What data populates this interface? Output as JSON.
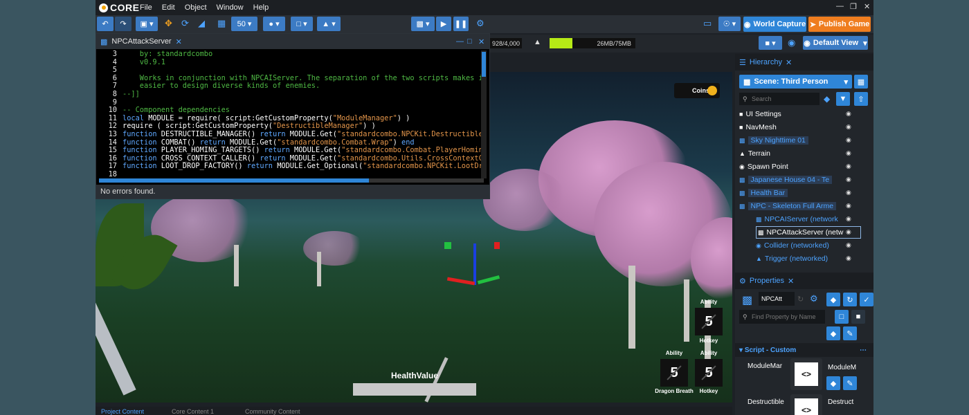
{
  "app": {
    "logo": "CORE"
  },
  "menu": [
    "File",
    "Edit",
    "Object",
    "Window",
    "Help"
  ],
  "toolbar": {
    "grid_size": "50",
    "world_capture": "World Capture",
    "publish": "Publish Game"
  },
  "stats": {
    "instances": "928/4,000",
    "memory": "26MB/75MB",
    "memory_fill_percent": 27
  },
  "view": {
    "default_view": "Default View"
  },
  "editor": {
    "tab": "NPCAttackServer",
    "status": "No errors found.",
    "lines": [
      {
        "n": "3",
        "parts": [
          {
            "t": "    by: standardcombo",
            "c": "cmt"
          }
        ]
      },
      {
        "n": "4",
        "parts": [
          {
            "t": "    v0.9.1",
            "c": "cmt"
          }
        ]
      },
      {
        "n": "5",
        "parts": [
          {
            "t": "",
            "c": "src"
          }
        ]
      },
      {
        "n": "6",
        "parts": [
          {
            "t": "    Works in conjunction with NPCAIServer. The separation of the two scripts makes it",
            "c": "cmt"
          }
        ]
      },
      {
        "n": "7",
        "parts": [
          {
            "t": "    easier to design diverse kinds of enemies.",
            "c": "cmt"
          }
        ]
      },
      {
        "n": "8",
        "parts": [
          {
            "t": "--]]",
            "c": "cmt"
          }
        ]
      },
      {
        "n": "9",
        "parts": [
          {
            "t": "",
            "c": "src"
          }
        ]
      },
      {
        "n": "10",
        "parts": [
          {
            "t": "-- Component dependencies",
            "c": "cmt"
          }
        ]
      },
      {
        "n": "11",
        "parts": [
          {
            "t": "local",
            "c": "kw"
          },
          {
            "t": " MODULE = require( script:GetCustomProperty(",
            "c": "src"
          },
          {
            "t": "\"ModuleManager\"",
            "c": "str"
          },
          {
            "t": ") )",
            "c": "src"
          }
        ]
      },
      {
        "n": "12",
        "parts": [
          {
            "t": "require ( script:GetCustomProperty(",
            "c": "src"
          },
          {
            "t": "\"DestructibleManager\"",
            "c": "str"
          },
          {
            "t": ") )",
            "c": "src"
          }
        ]
      },
      {
        "n": "13",
        "parts": [
          {
            "t": "function",
            "c": "kw"
          },
          {
            "t": " DESTRUCTIBLE_MANAGER() ",
            "c": "src"
          },
          {
            "t": "return",
            "c": "kw"
          },
          {
            "t": " MODULE.Get(",
            "c": "src"
          },
          {
            "t": "\"standardcombo.NPCKit.DestructibleMan",
            "c": "str"
          }
        ]
      },
      {
        "n": "14",
        "parts": [
          {
            "t": "function",
            "c": "kw"
          },
          {
            "t": " COMBAT() ",
            "c": "src"
          },
          {
            "t": "return",
            "c": "kw"
          },
          {
            "t": " MODULE.Get(",
            "c": "src"
          },
          {
            "t": "\"standardcombo.Combat.Wrap\"",
            "c": "str"
          },
          {
            "t": ") ",
            "c": "src"
          },
          {
            "t": "end",
            "c": "kw"
          }
        ]
      },
      {
        "n": "15",
        "parts": [
          {
            "t": "function",
            "c": "kw"
          },
          {
            "t": " PLAYER_HOMING_TARGETS() ",
            "c": "src"
          },
          {
            "t": "return",
            "c": "kw"
          },
          {
            "t": " MODULE.Get(",
            "c": "src"
          },
          {
            "t": "\"standardcombo.Combat.PlayerHomingTa",
            "c": "str"
          }
        ]
      },
      {
        "n": "16",
        "parts": [
          {
            "t": "function",
            "c": "kw"
          },
          {
            "t": " CROSS_CONTEXT_CALLER() ",
            "c": "src"
          },
          {
            "t": "return",
            "c": "kw"
          },
          {
            "t": " MODULE.Get(",
            "c": "src"
          },
          {
            "t": "\"standardcombo.Utils.CrossContextCall",
            "c": "str"
          }
        ]
      },
      {
        "n": "17",
        "parts": [
          {
            "t": "function",
            "c": "kw"
          },
          {
            "t": " LOOT_DROP_FACTORY() ",
            "c": "src"
          },
          {
            "t": "return",
            "c": "kw"
          },
          {
            "t": " MODULE.Get_Optional(",
            "c": "src"
          },
          {
            "t": "\"standardcombo.NPCKit.LootDropF",
            "c": "str"
          }
        ]
      },
      {
        "n": "18",
        "parts": [
          {
            "t": "",
            "c": "src"
          }
        ]
      }
    ]
  },
  "hud": {
    "coins_label": "Coins",
    "abilities": [
      {
        "label": "Ability",
        "value": "5",
        "hotkey": "Hotkey"
      },
      {
        "label": "Ability",
        "value": "5",
        "hotkey": "Dragon Breath"
      },
      {
        "label": "Ability",
        "value": "5",
        "hotkey": "Hotkey"
      }
    ],
    "health_label": "HealthValue"
  },
  "hierarchy": {
    "title": "Hierarchy",
    "scene": "Scene: Third Person",
    "search_placeholder": "Search",
    "items": [
      {
        "label": "UI Settings",
        "style": "white"
      },
      {
        "label": "NavMesh",
        "style": "white"
      },
      {
        "label": "Sky Nighttime 01",
        "style": "blue-sel"
      },
      {
        "label": "Terrain",
        "style": "white"
      },
      {
        "label": "Spawn Point",
        "style": "white"
      },
      {
        "label": "Japanese House 04 - Te",
        "style": "blue-sel"
      },
      {
        "label": "Health Bar",
        "style": "blue-sel"
      },
      {
        "label": "NPC - Skeleton Full Arme",
        "style": "blue-sel"
      },
      {
        "label": "NPCAIServer (network",
        "style": "blue"
      },
      {
        "label": "NPCAttackServer (netw",
        "style": "white-selected"
      },
      {
        "label": "Collider (networked)",
        "style": "blue"
      },
      {
        "label": "Trigger (networked)",
        "style": "blue"
      }
    ]
  },
  "properties": {
    "title": "Properties",
    "name_value": "NPCAtt",
    "find_placeholder": "Find Property by Name",
    "section": "Script - Custom",
    "custom": [
      {
        "label": "ModuleMar",
        "value": "ModuleM"
      },
      {
        "label": "Destructible",
        "value": "Destruct"
      }
    ]
  },
  "bottom_tabs": [
    "Project Content",
    "Core Content 1",
    "Community Content"
  ]
}
